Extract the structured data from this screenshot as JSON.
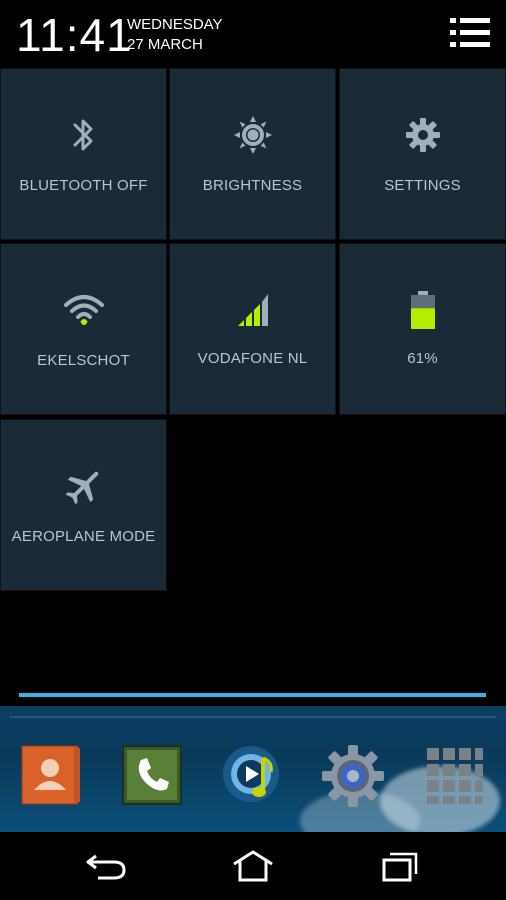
{
  "status": {
    "time": "11:41",
    "day": "WEDNESDAY",
    "date": "27 MARCH"
  },
  "header": {
    "menu_icon": "list-menu-icon"
  },
  "tiles": [
    {
      "label": "BLUETOOTH OFF",
      "icon": "bluetooth-icon"
    },
    {
      "label": "BRIGHTNESS",
      "icon": "brightness-icon"
    },
    {
      "label": "SETTINGS",
      "icon": "gear-icon"
    },
    {
      "label": "EKELSCHOT",
      "icon": "wifi-icon"
    },
    {
      "label": "VODAFONE NL",
      "icon": "signal-icon"
    },
    {
      "label": "61%",
      "icon": "battery-icon",
      "battery_level": 0.61
    },
    {
      "label": "AEROPLANE MODE",
      "icon": "airplane-icon"
    }
  ],
  "dock": {
    "apps": [
      {
        "icon": "contacts-icon"
      },
      {
        "icon": "phone-icon"
      },
      {
        "icon": "music-player-icon"
      },
      {
        "icon": "settings-app-icon"
      },
      {
        "icon": "app-drawer-icon"
      }
    ]
  },
  "navbar": {
    "buttons": [
      "back-icon",
      "home-icon",
      "recent-apps-icon"
    ]
  },
  "colors": {
    "tile_bg": "#1a2a36",
    "accent_blue": "#33b5e5",
    "battery_green": "#b3f000",
    "icon_grey": "#9fb0bc"
  }
}
